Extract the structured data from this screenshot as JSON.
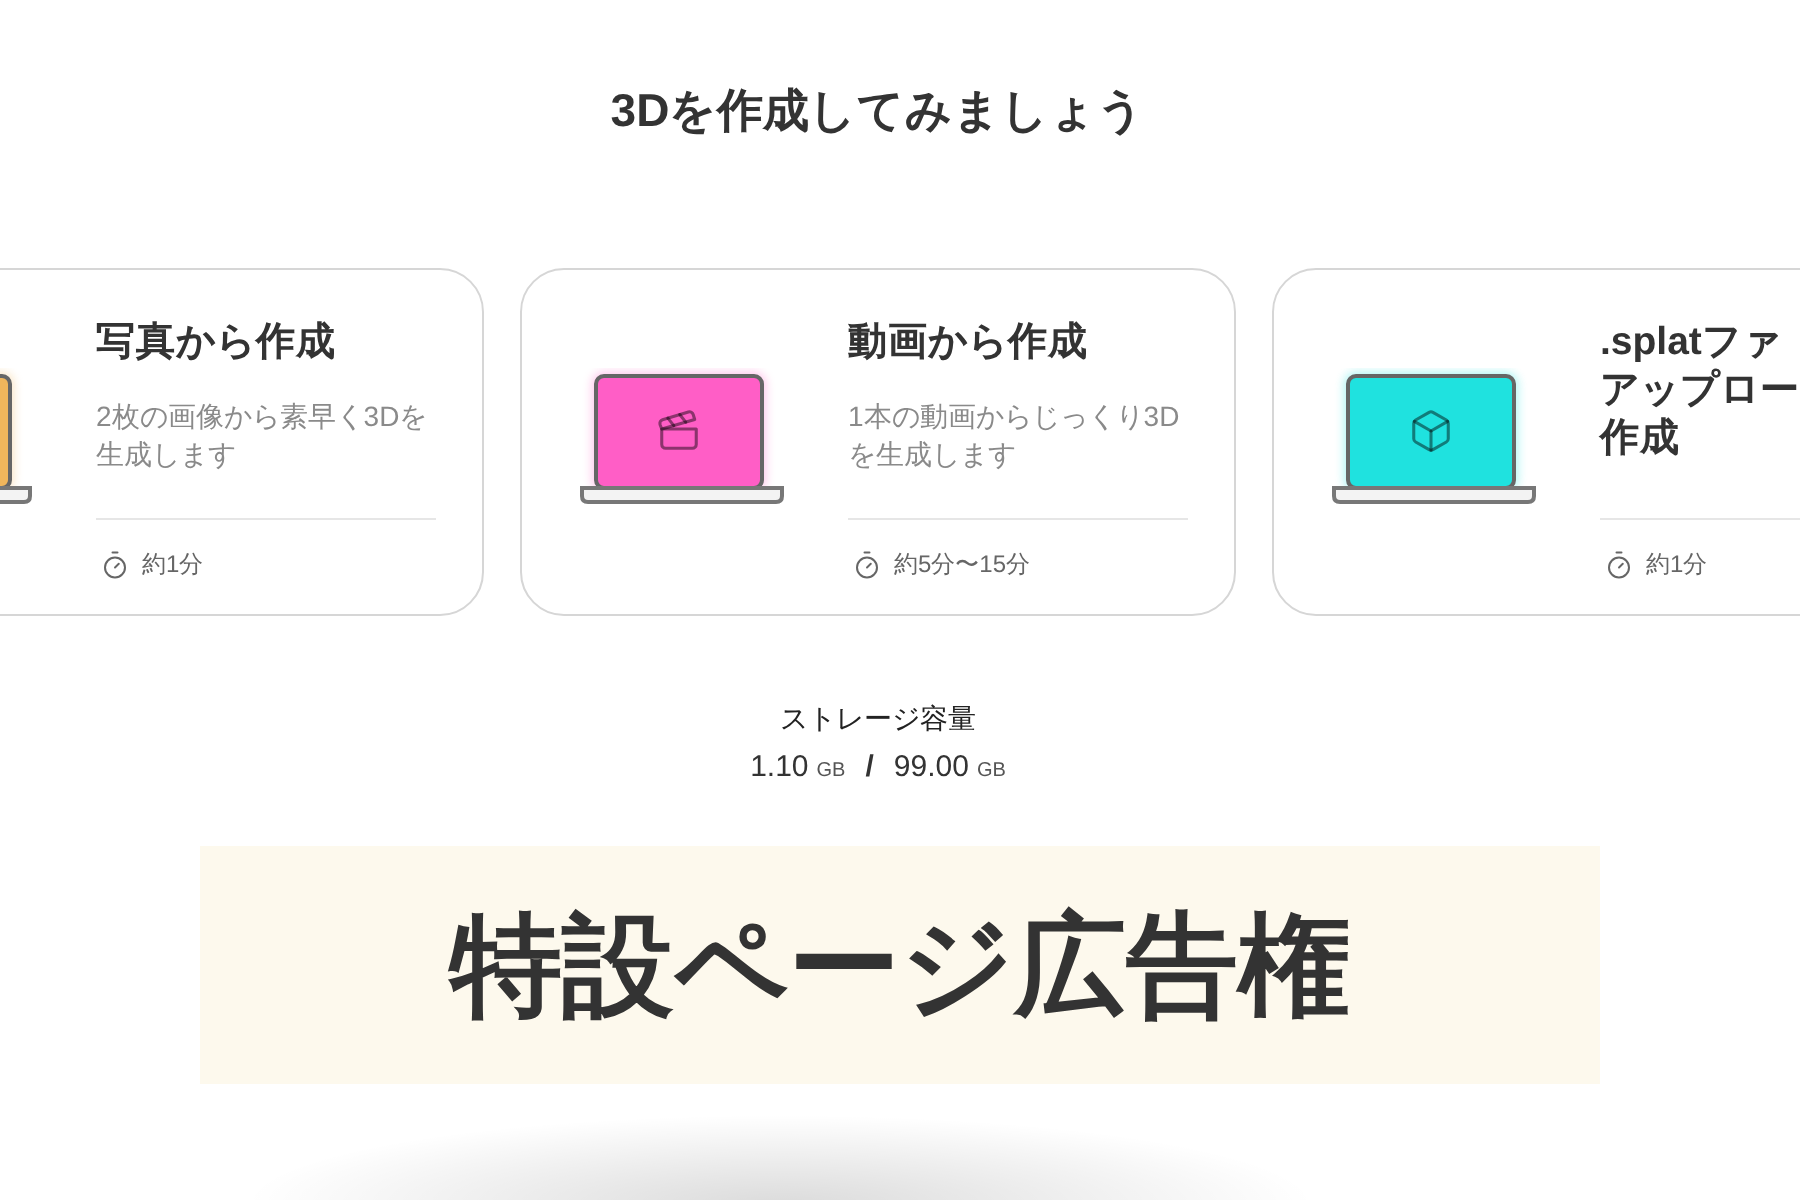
{
  "heading": "3Dを作成してみましょう",
  "cards": [
    {
      "kind": "photo",
      "color": "#f0b65c",
      "title_lines": [
        "写真から作成"
      ],
      "description": "2枚の画像から素早く3Dを生成します",
      "duration": "約1分"
    },
    {
      "kind": "video",
      "color": "#ff5ec6",
      "title_lines": [
        "動画から作成"
      ],
      "description": "1本の動画からじっくり3Dを生成します",
      "duration": "約5分〜15分"
    },
    {
      "kind": "file",
      "color": "#1fe2df",
      "title_lines": [
        ".splatファ",
        "アップロー",
        "作成"
      ],
      "duration": "約1分"
    }
  ],
  "storage": {
    "label": "ストレージ容量",
    "used": "1.10",
    "used_unit": "GB",
    "separator": "/",
    "total": "99.00",
    "total_unit": "GB"
  },
  "ad_banner": {
    "text": "特設ページ広告権"
  }
}
